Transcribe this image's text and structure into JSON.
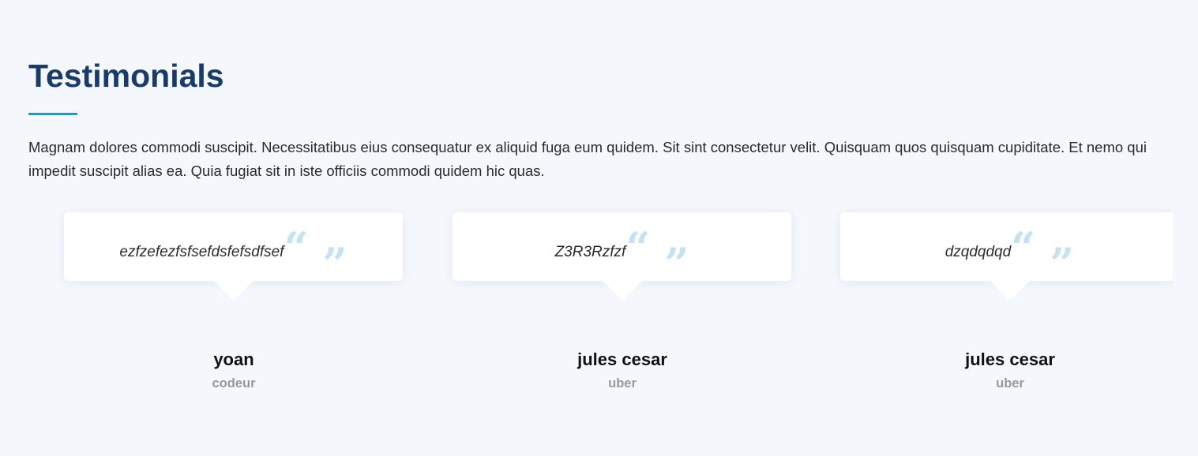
{
  "section": {
    "title": "Testimonials",
    "intro": "Magnam dolores commodi suscipit. Necessitatibus eius consequatur ex aliquid fuga eum quidem. Sit sint consectetur velit. Quisquam quos quisquam cupiditate. Et nemo qui impedit suscipit alias ea. Quia fugiat sit in iste officiis commodi quidem hic quas."
  },
  "testimonials": [
    {
      "quote": "ezfzefezfsfsefdsfefsdfsef",
      "name": "yoan",
      "role": "codeur",
      "quote_open_icon": "quote-left-icon",
      "quote_close_icon": "quote-right-icon"
    },
    {
      "quote": "Z3R3Rzfzf",
      "name": "jules cesar",
      "role": "uber",
      "quote_open_icon": "quote-left-icon",
      "quote_close_icon": "quote-right-icon"
    },
    {
      "quote": "dzqdqdqd",
      "name": "jules cesar",
      "role": "uber",
      "quote_open_icon": "quote-left-icon",
      "quote_close_icon": "quote-right-icon"
    }
  ],
  "colors": {
    "background": "#f4f7fc",
    "title": "#173b6c",
    "accent": "#1f97d4",
    "quote_icon": "#c3e3f5",
    "role_text": "#999999"
  }
}
